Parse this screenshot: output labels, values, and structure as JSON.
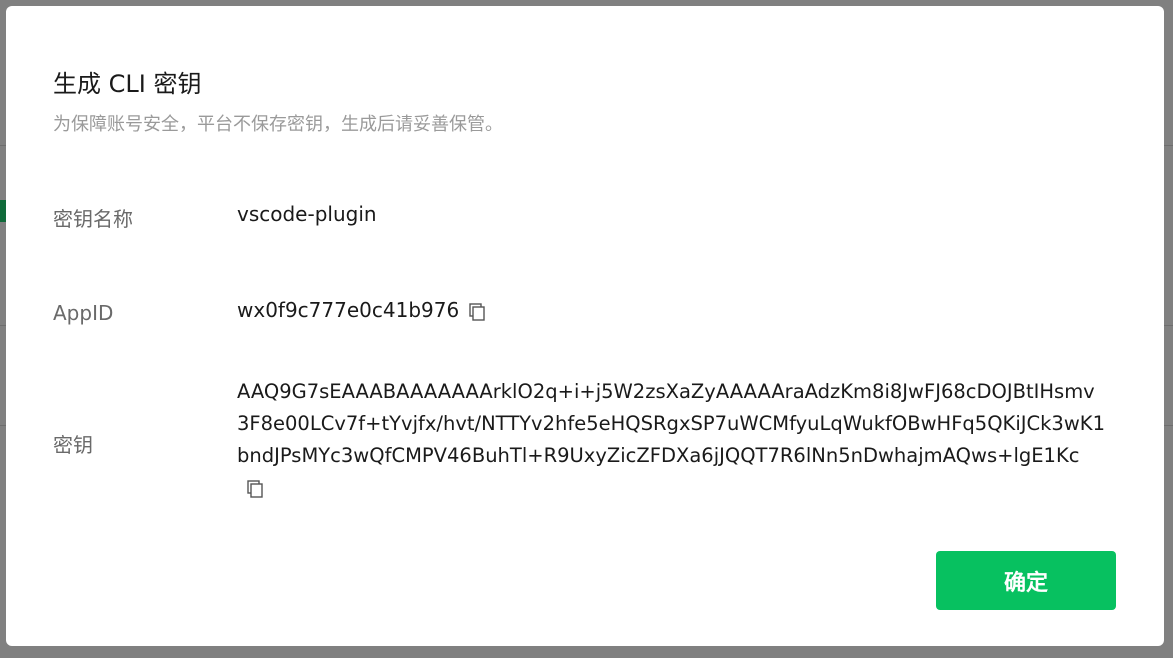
{
  "dialog": {
    "title": "生成 CLI 密钥",
    "subtitle": "为保障账号安全，平台不保存密钥，生成后请妥善保管。",
    "fields": [
      {
        "label": "密钥名称",
        "value": "vscode-plugin"
      },
      {
        "label": "AppID",
        "value": "wx0f9c777e0c41b976"
      },
      {
        "label": "密钥",
        "value": "AAQ9G7sEAAABAAAAAAArklO2q+i+j5W2zsXaZyAAAAAraAdzKm8i8JwFJ68cDOJBtIHsmv3F8e00LCv7f+tYvjfx/hvt/NTTYv2hfe5eHQSRgxSP7uWCMfyuLqWukfOBwHFq5QKiJCk3wK1bndJPsMYc3wQfCMPV46BuhTl+R9UxyZicZFDXa6jJQQT7R6lNn5nDwhajmAQws+lgE1Kc"
      }
    ],
    "confirm_label": "确定"
  },
  "icons": {
    "copy": "copy-icon"
  },
  "colors": {
    "primary": "#07c160",
    "overlay": "#808080"
  }
}
